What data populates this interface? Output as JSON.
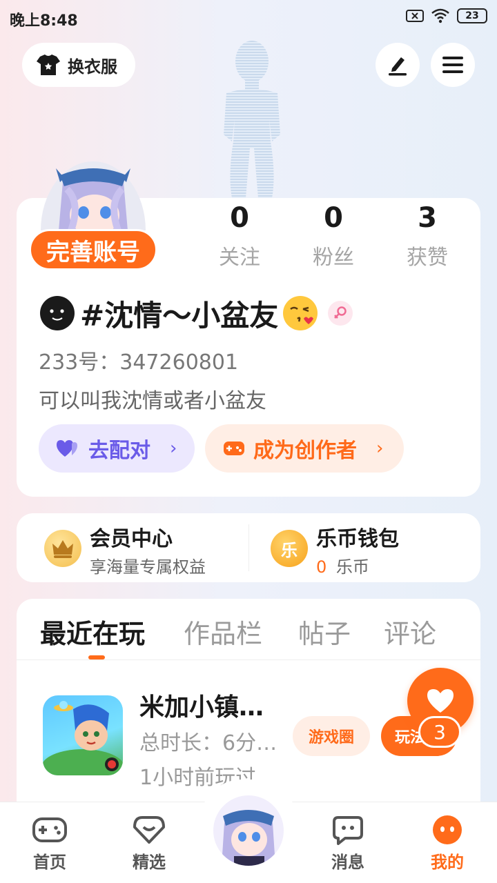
{
  "status_bar": {
    "time": "晚上8:48",
    "battery": "23"
  },
  "header": {
    "dress_label": "换衣服"
  },
  "profile": {
    "complete_label": "完善账号",
    "stats": [
      {
        "num": "0",
        "label": "关注"
      },
      {
        "num": "0",
        "label": "粉丝"
      },
      {
        "num": "3",
        "label": "获赞"
      }
    ],
    "name": "#沈情～小盆友",
    "id_line": "233号：347260801",
    "bio": "可以叫我沈情或者小盆友",
    "pair_label": "去配对",
    "creator_label": "成为创作者",
    "chevron": "›"
  },
  "member": {
    "vip_title": "会员中心",
    "vip_sub": "享海量专属权益",
    "wallet_title": "乐币钱包",
    "wallet_amount": "0",
    "wallet_unit": "乐币",
    "coin_glyph": "乐"
  },
  "tabs": [
    "最近在玩",
    "作品栏",
    "帖子",
    "评论"
  ],
  "recent_game": {
    "title": "米加小镇…",
    "duration": "总时长：6分…",
    "last_played": "1小时前玩过",
    "circle_btn": "游戏圈",
    "play_btn": "玩法"
  },
  "like_fab": {
    "count": "3"
  },
  "bottom_nav": {
    "home": "首页",
    "featured": "精选",
    "messages": "消息",
    "mine": "我的"
  },
  "colors": {
    "accent": "#ff6b1a",
    "purple": "#6a5be8"
  }
}
